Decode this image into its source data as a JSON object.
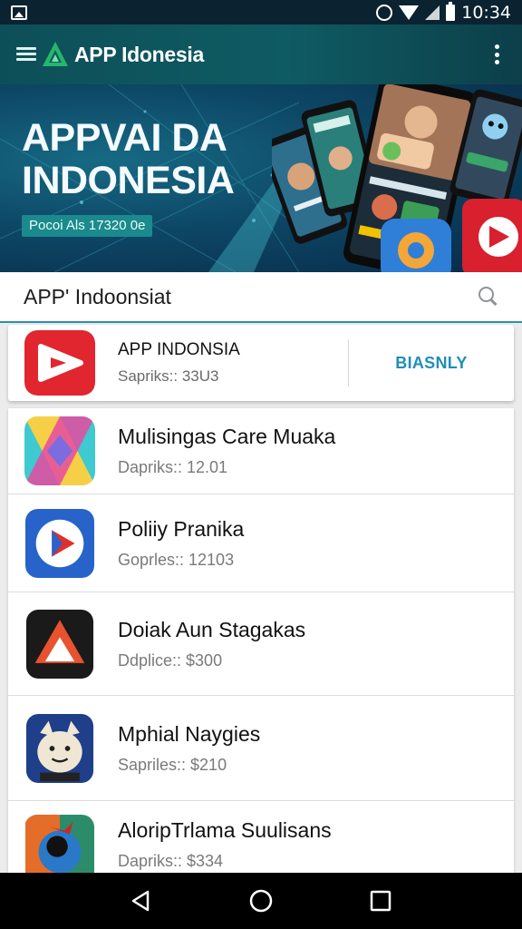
{
  "status_bar": {
    "time": "10:34",
    "icons": [
      "gallery-icon",
      "alarm-icon",
      "wifi-icon",
      "signal-icon",
      "battery-icon"
    ]
  },
  "app_bar": {
    "title": "APP Idonesia",
    "icons": [
      "menu-icon",
      "logo-icon",
      "more-vert-icon"
    ]
  },
  "banner": {
    "title_line1": "APPVAI DA",
    "title_line2": "INDONESIA",
    "tag": "Pocoi Als 17320 0e"
  },
  "search": {
    "value": "APP' Indoonsiat",
    "icon": "search-icon"
  },
  "featured": {
    "name": "APP INDONSIA",
    "meta": "Sapriks:: 33U3",
    "action_label": "BIASNLY",
    "icon": "play-triangle-icon"
  },
  "apps": [
    {
      "name": "Mulisingas Care Muaka",
      "meta": "Dapriks:: 12.01",
      "icon": "colorful-x-icon"
    },
    {
      "name": "Poliiy Pranika",
      "meta": "Goprles:: 12103",
      "icon": "play-arrow-icon"
    },
    {
      "name": "Doiak Aun Stagakas",
      "meta": "Ddplice:: $300",
      "icon": "triangle-a-icon"
    },
    {
      "name": "Mphial Naygies",
      "meta": "Sapriles:: $210",
      "icon": "cat-face-icon"
    },
    {
      "name": "AloripTrlama Suulisans",
      "meta": "Dapriks:: $334",
      "icon": "bird-icon"
    }
  ],
  "nav_bar": {
    "icons": [
      "back-icon",
      "home-icon",
      "recents-icon"
    ]
  },
  "colors": {
    "status_bar": "#0b2330",
    "app_bar": "#0f5b63",
    "banner": "#0d4766",
    "accent": "#1f8fb5",
    "logo_green": "#25b86b"
  }
}
